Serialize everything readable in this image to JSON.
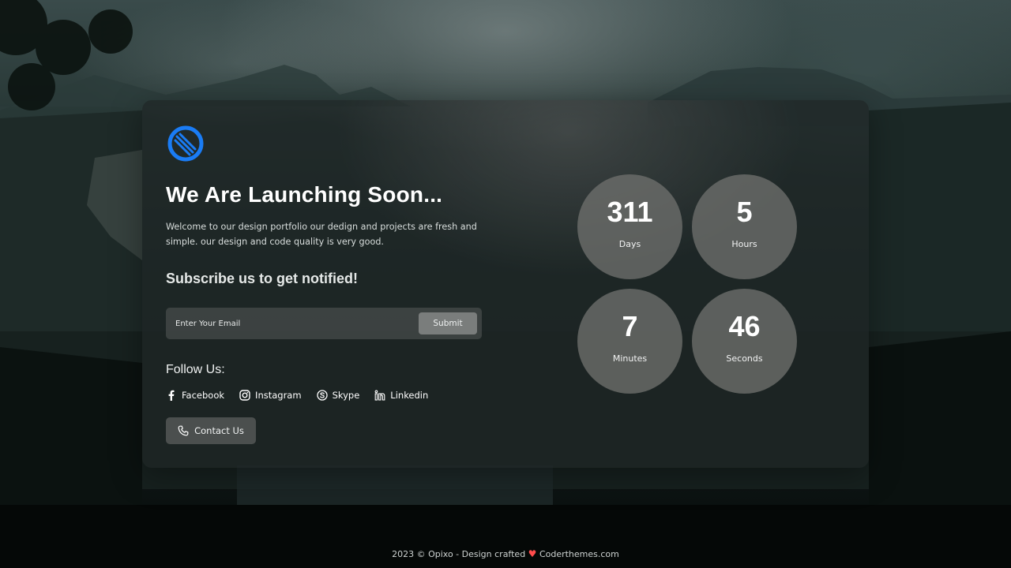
{
  "brand": {
    "accent": "#1a7cf5",
    "logo_icon": "ring-logo-icon"
  },
  "hero": {
    "title": "We Are Launching Soon...",
    "description": "Welcome to our design portfolio our dedign and projects are fresh and simple. our design and code quality is very good."
  },
  "subscribe": {
    "heading": "Subscribe us to get notified!",
    "placeholder": "Enter Your Email",
    "submit_label": "Submit"
  },
  "follow": {
    "heading": "Follow Us:",
    "links": [
      {
        "label": "Facebook",
        "icon": "facebook-icon"
      },
      {
        "label": "Instagram",
        "icon": "instagram-icon"
      },
      {
        "label": "Skype",
        "icon": "skype-icon"
      },
      {
        "label": "Linkedin",
        "icon": "linkedin-icon"
      }
    ]
  },
  "contact": {
    "label": "Contact Us",
    "icon": "phone-icon"
  },
  "countdown": {
    "days": {
      "value": "311",
      "label": "Days"
    },
    "hours": {
      "value": "5",
      "label": "Hours"
    },
    "minutes": {
      "value": "7",
      "label": "Minutes"
    },
    "seconds": {
      "value": "46",
      "label": "Seconds"
    }
  },
  "footer": {
    "prefix": "2023 © Opixo - Design crafted",
    "heart": "♥",
    "suffix": "Coderthemes.com"
  }
}
